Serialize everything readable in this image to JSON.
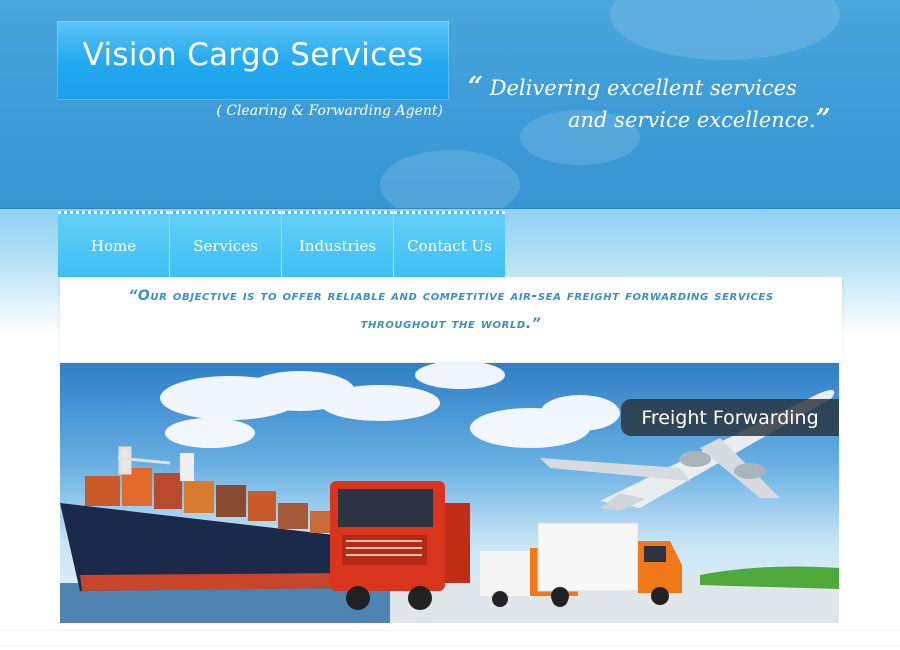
{
  "header": {
    "logo_title": "Vision Cargo Services",
    "logo_subtitle": "( Clearing & Forwarding Agent)",
    "tagline_line1": "Delivering excellent services",
    "tagline_line2": "and service excellence.",
    "open_quote": "“",
    "close_quote": "”"
  },
  "nav": {
    "items": [
      {
        "label": "Home"
      },
      {
        "label": "Services"
      },
      {
        "label": "Industries"
      },
      {
        "label": "Contact Us"
      }
    ]
  },
  "objective": {
    "text": "“Our objective is to offer reliable and competitive air-sea freight forwarding services throughout the world.”"
  },
  "banner": {
    "label": "Freight Forwarding"
  },
  "colors": {
    "header_blue": "#3b9bd6",
    "logo_blue": "#22a9ee",
    "nav_blue": "#3ebff3",
    "objective_text": "#3a8fc8",
    "truck_red": "#d8351c",
    "van_orange": "#f07818",
    "ship_hull": "#1b2a4a"
  }
}
